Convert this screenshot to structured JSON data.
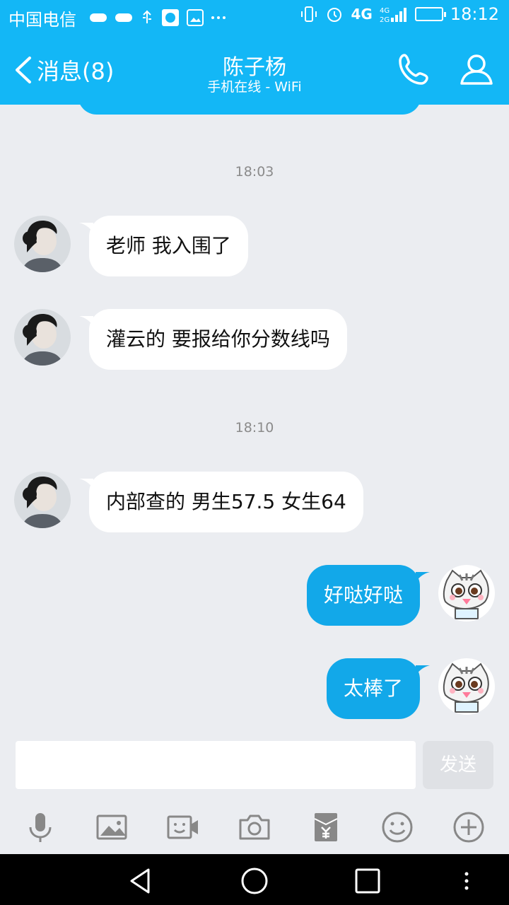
{
  "status_bar": {
    "carrier": "中国电信",
    "network": "4G",
    "network_secondary": "4G 2G",
    "time": "18:12",
    "icons": [
      "notification-badge-icon",
      "notification-badge-icon",
      "usb-icon",
      "app-icon",
      "image-icon",
      "more-icon",
      "vibrate-icon",
      "alarm-icon",
      "signal-icon",
      "battery-icon"
    ]
  },
  "header": {
    "back_label": "消息(8)",
    "title": "陈子杨",
    "subtitle": "手机在线 - WiFi"
  },
  "messages": [
    {
      "type": "time",
      "text": "18:03"
    },
    {
      "type": "in",
      "text": "老师 我入围了"
    },
    {
      "type": "in",
      "text": "灌云的  要报给你分数线吗"
    },
    {
      "type": "time",
      "text": "18:10"
    },
    {
      "type": "in",
      "text": "内部查的  男生57.5  女生64"
    },
    {
      "type": "out",
      "text": "好哒好哒"
    },
    {
      "type": "out",
      "text": "太棒了"
    }
  ],
  "input": {
    "value": "",
    "placeholder": "",
    "send_label": "发送"
  },
  "toolbar": [
    "microphone-icon",
    "picture-icon",
    "video-icon",
    "camera-icon",
    "red-packet-icon",
    "emoji-icon",
    "plus-icon"
  ],
  "colors": {
    "accent": "#13b7f6",
    "out_bubble": "#12a8e9",
    "background": "#ebedf1"
  }
}
